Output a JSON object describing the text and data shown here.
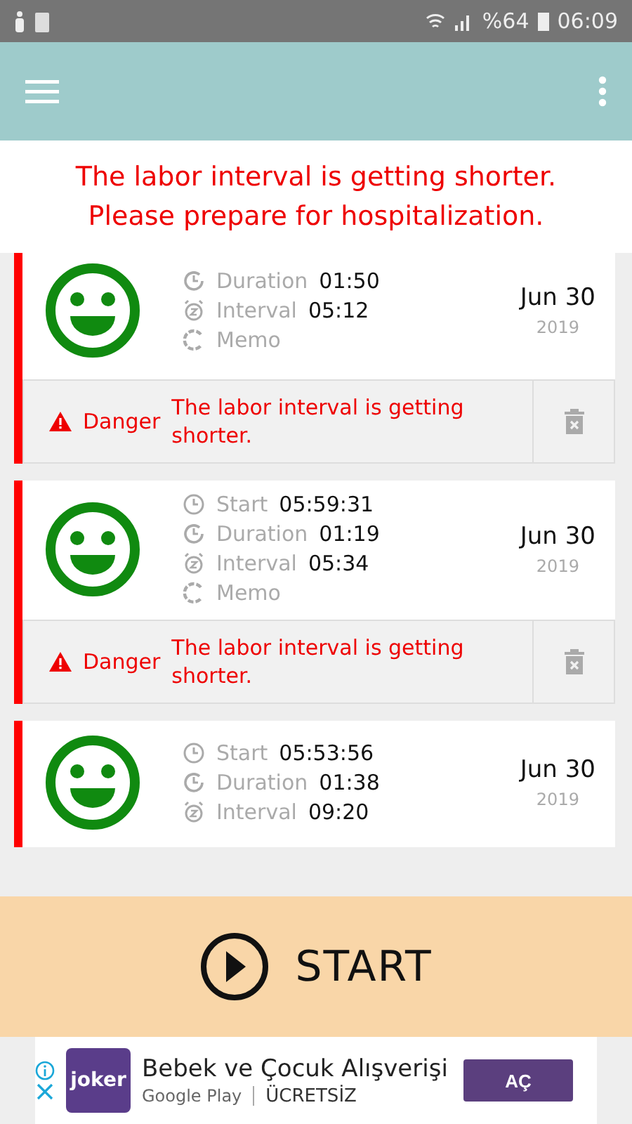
{
  "status_bar": {
    "battery": "%64",
    "time": "06:09"
  },
  "banner": {
    "text": "The labor interval is getting shorter.\nPlease prepare for hospitalization."
  },
  "records": [
    {
      "rows": [
        {
          "kind": "duration",
          "label": "Duration",
          "value": "01:50"
        },
        {
          "kind": "interval",
          "label": "Interval",
          "value": "05:12"
        },
        {
          "kind": "memo",
          "label": "Memo"
        }
      ],
      "date": "Jun 30",
      "year": "2019",
      "alert": {
        "level": "Danger",
        "message": "The labor interval is getting shorter."
      }
    },
    {
      "rows": [
        {
          "kind": "start",
          "label": "Start",
          "value": "05:59:31"
        },
        {
          "kind": "duration",
          "label": "Duration",
          "value": "01:19"
        },
        {
          "kind": "interval",
          "label": "Interval",
          "value": "05:34"
        },
        {
          "kind": "memo",
          "label": "Memo"
        }
      ],
      "date": "Jun 30",
      "year": "2019",
      "alert": {
        "level": "Danger",
        "message": "The labor interval is getting shorter."
      }
    },
    {
      "rows": [
        {
          "kind": "start",
          "label": "Start",
          "value": "05:53:56"
        },
        {
          "kind": "duration",
          "label": "Duration",
          "value": "01:38"
        },
        {
          "kind": "interval",
          "label": "Interval",
          "value": "09:20"
        }
      ],
      "date": "Jun 30",
      "year": "2019"
    }
  ],
  "start_button": {
    "label": "START"
  },
  "ad": {
    "logo": "joker",
    "title": "Bebek ve Çocuk Alışverişi",
    "store": "Google Play",
    "price": "ÜCRETSİZ",
    "button": "AÇ"
  }
}
